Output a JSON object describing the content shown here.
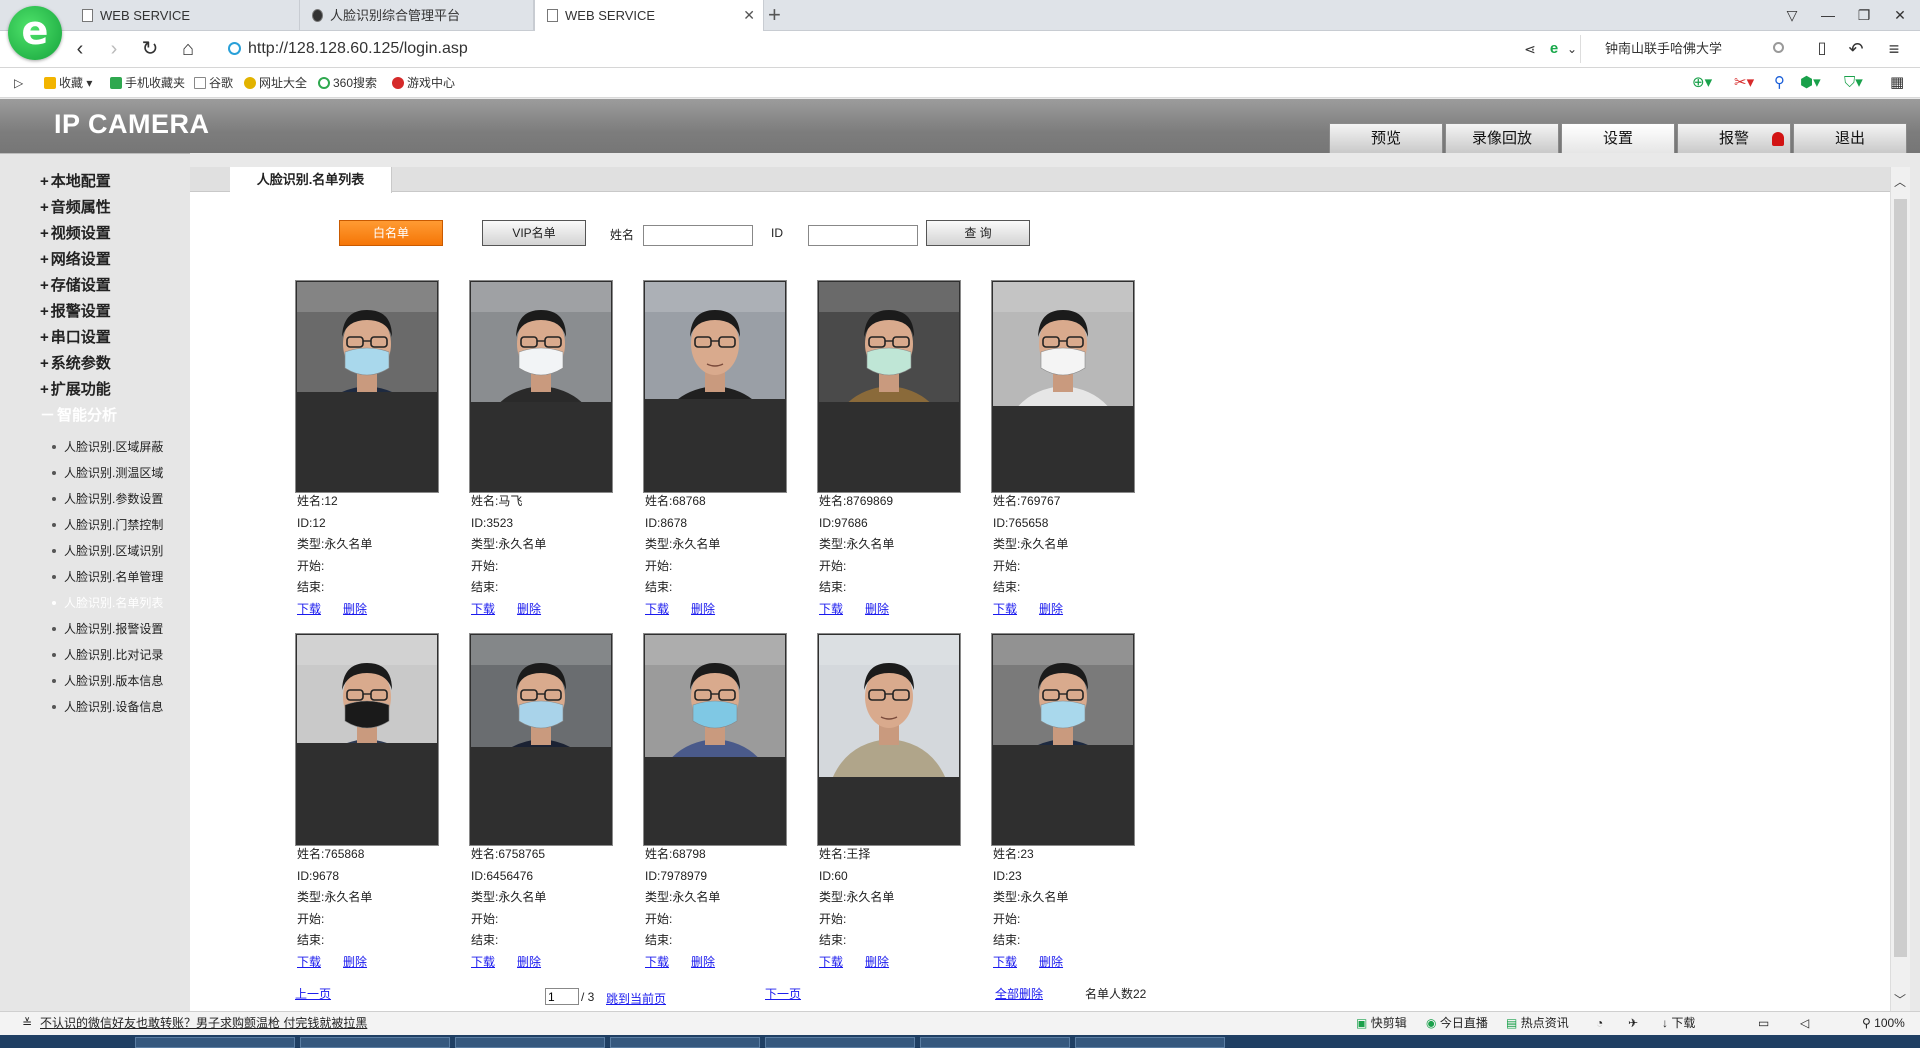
{
  "browser": {
    "tabs": [
      {
        "label": "WEB SERVICE",
        "active": false
      },
      {
        "label": "人脸识别综合管理平台",
        "active": false
      },
      {
        "label": "WEB SERVICE",
        "active": true
      }
    ],
    "url": "http://128.128.60.125/login.asp",
    "search_text": "钟南山联手哈佛大学",
    "bookmarks": [
      "收藏",
      "手机收藏夹",
      "谷歌",
      "网址大全",
      "360搜索",
      "游戏中心"
    ]
  },
  "camera": {
    "title": "IP CAMERA",
    "nav": [
      "预览",
      "录像回放",
      "设置",
      "报警",
      "退出"
    ],
    "nav_active": "设置",
    "menu": [
      "本地配置",
      "音频属性",
      "视频设置",
      "网络设置",
      "存储设置",
      "报警设置",
      "串口设置",
      "系统参数",
      "扩展功能",
      "智能分析"
    ],
    "menu_open": "智能分析",
    "submenu": [
      "人脸识别.区域屏蔽",
      "人脸识别.测温区域",
      "人脸识别.参数设置",
      "人脸识别.门禁控制",
      "人脸识别.区域识别",
      "人脸识别.名单管理",
      "人脸识别.名单列表",
      "人脸识别.报警设置",
      "人脸识别.比对记录",
      "人脸识别.版本信息",
      "人脸识别.设备信息"
    ],
    "submenu_active": "人脸识别.名单列表",
    "content_tab": "人脸识别.名单列表",
    "filter": {
      "white_list": "白名单",
      "vip_list": "VIP名单",
      "name_label": "姓名",
      "id_label": "ID",
      "query": "查 询"
    },
    "labels": {
      "name": "姓名:",
      "id": "ID:",
      "type": "类型:",
      "start": "开始:",
      "end": "结束:",
      "download": "下载",
      "delete": "删除"
    },
    "people": [
      {
        "name": "12",
        "id": "12",
        "type": "永久名单",
        "mask": "#a9d8ec",
        "bg": "#6a6a6a",
        "shirt": "#1e2a40",
        "photo_h": 110
      },
      {
        "name": "马飞",
        "id": "3523",
        "type": "永久名单",
        "mask": "#f2f4f6",
        "bg": "#8a8d90",
        "shirt": "#2a2a2a",
        "photo_h": 120
      },
      {
        "name": "68768",
        "id": "8678",
        "type": "永久名单",
        "mask": "none",
        "bg": "#9a9fa6",
        "shirt": "#202020",
        "photo_h": 117
      },
      {
        "name": "8769869",
        "id": "97686",
        "type": "永久名单",
        "mask": "#bfe6d6",
        "bg": "#4a4a4a",
        "shirt": "#8a6a3a",
        "photo_h": 120
      },
      {
        "name": "769767",
        "id": "765658",
        "type": "永久名单",
        "mask": "#f4f4f4",
        "bg": "#b8b8b8",
        "shirt": "#e6e6e6",
        "photo_h": 124
      },
      {
        "name": "765868",
        "id": "9678",
        "type": "永久名单",
        "mask": "#1a1a1a",
        "bg": "#c9c9c9",
        "shirt": "#2e3a52",
        "photo_h": 108
      },
      {
        "name": "6758765",
        "id": "6456476",
        "type": "永久名单",
        "mask": "#a9d3ea",
        "bg": "#6a6d70",
        "shirt": "#1b2233",
        "photo_h": 112
      },
      {
        "name": "68798",
        "id": "7978979",
        "type": "永久名单",
        "mask": "#7fc8e4",
        "bg": "#9b9b9b",
        "shirt": "#4a5a8a",
        "photo_h": 122
      },
      {
        "name": "王择",
        "id": "60",
        "type": "永久名单",
        "mask": "none",
        "bg": "#d4d8dc",
        "shirt": "#b0a58a",
        "photo_h": 142
      },
      {
        "name": "23",
        "id": "23",
        "type": "永久名单",
        "mask": "#a9d8ec",
        "bg": "#7a7a7a",
        "shirt": "#1e2a40",
        "photo_h": 110
      }
    ],
    "pager": {
      "prev": "上一页",
      "page": "1",
      "total": "/ 3",
      "jump": "跳到当前页",
      "next": "下一页",
      "delete_all": "全部删除",
      "count_label": "名单人数22"
    }
  },
  "statusbar": {
    "news": "不认识的微信好友也敢转账？男子求购颤温枪 付完钱就被拉黑",
    "items": [
      "快剪辑",
      "今日直播",
      "热点资讯",
      "下载",
      "100%"
    ]
  }
}
